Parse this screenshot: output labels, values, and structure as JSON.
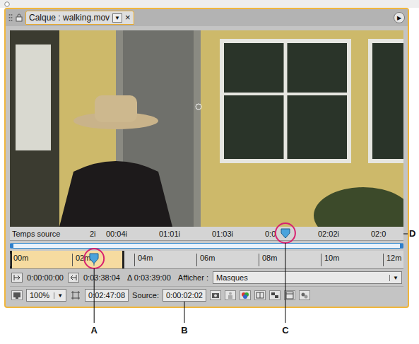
{
  "window": {
    "title": "Calque : walking.mov",
    "tab_menu": "▼",
    "close": "×",
    "panel_menu": "▶"
  },
  "time_ruler": {
    "label": "Temps source",
    "ticks": [
      "2i",
      "00:04i",
      "01:01i",
      "01:03i",
      "0:0",
      "02:02i",
      "02:0"
    ],
    "marker_level": 0.7
  },
  "frame_ruler": {
    "ticks": [
      "00m",
      "02m",
      "04m",
      "06m",
      "08m",
      "10m",
      "12m"
    ],
    "work_area_level": 0.29,
    "marker_level": 0.214
  },
  "controls": {
    "in_time": "0:00:00:00",
    "out_time": "0:03:38:04",
    "duration": "Δ 0:03:39:00",
    "view_label": "Afficher :",
    "view_value": "Masques",
    "view_menu": "▼"
  },
  "footer": {
    "zoom": "100%",
    "zoom_menu": "▼",
    "current_time": "0:02:47:08",
    "source_label": "Source:",
    "source_time": "0:00:02:02"
  },
  "callouts": [
    {
      "label": "A"
    },
    {
      "label": "B"
    },
    {
      "label": "C"
    },
    {
      "label": "D"
    }
  ]
}
